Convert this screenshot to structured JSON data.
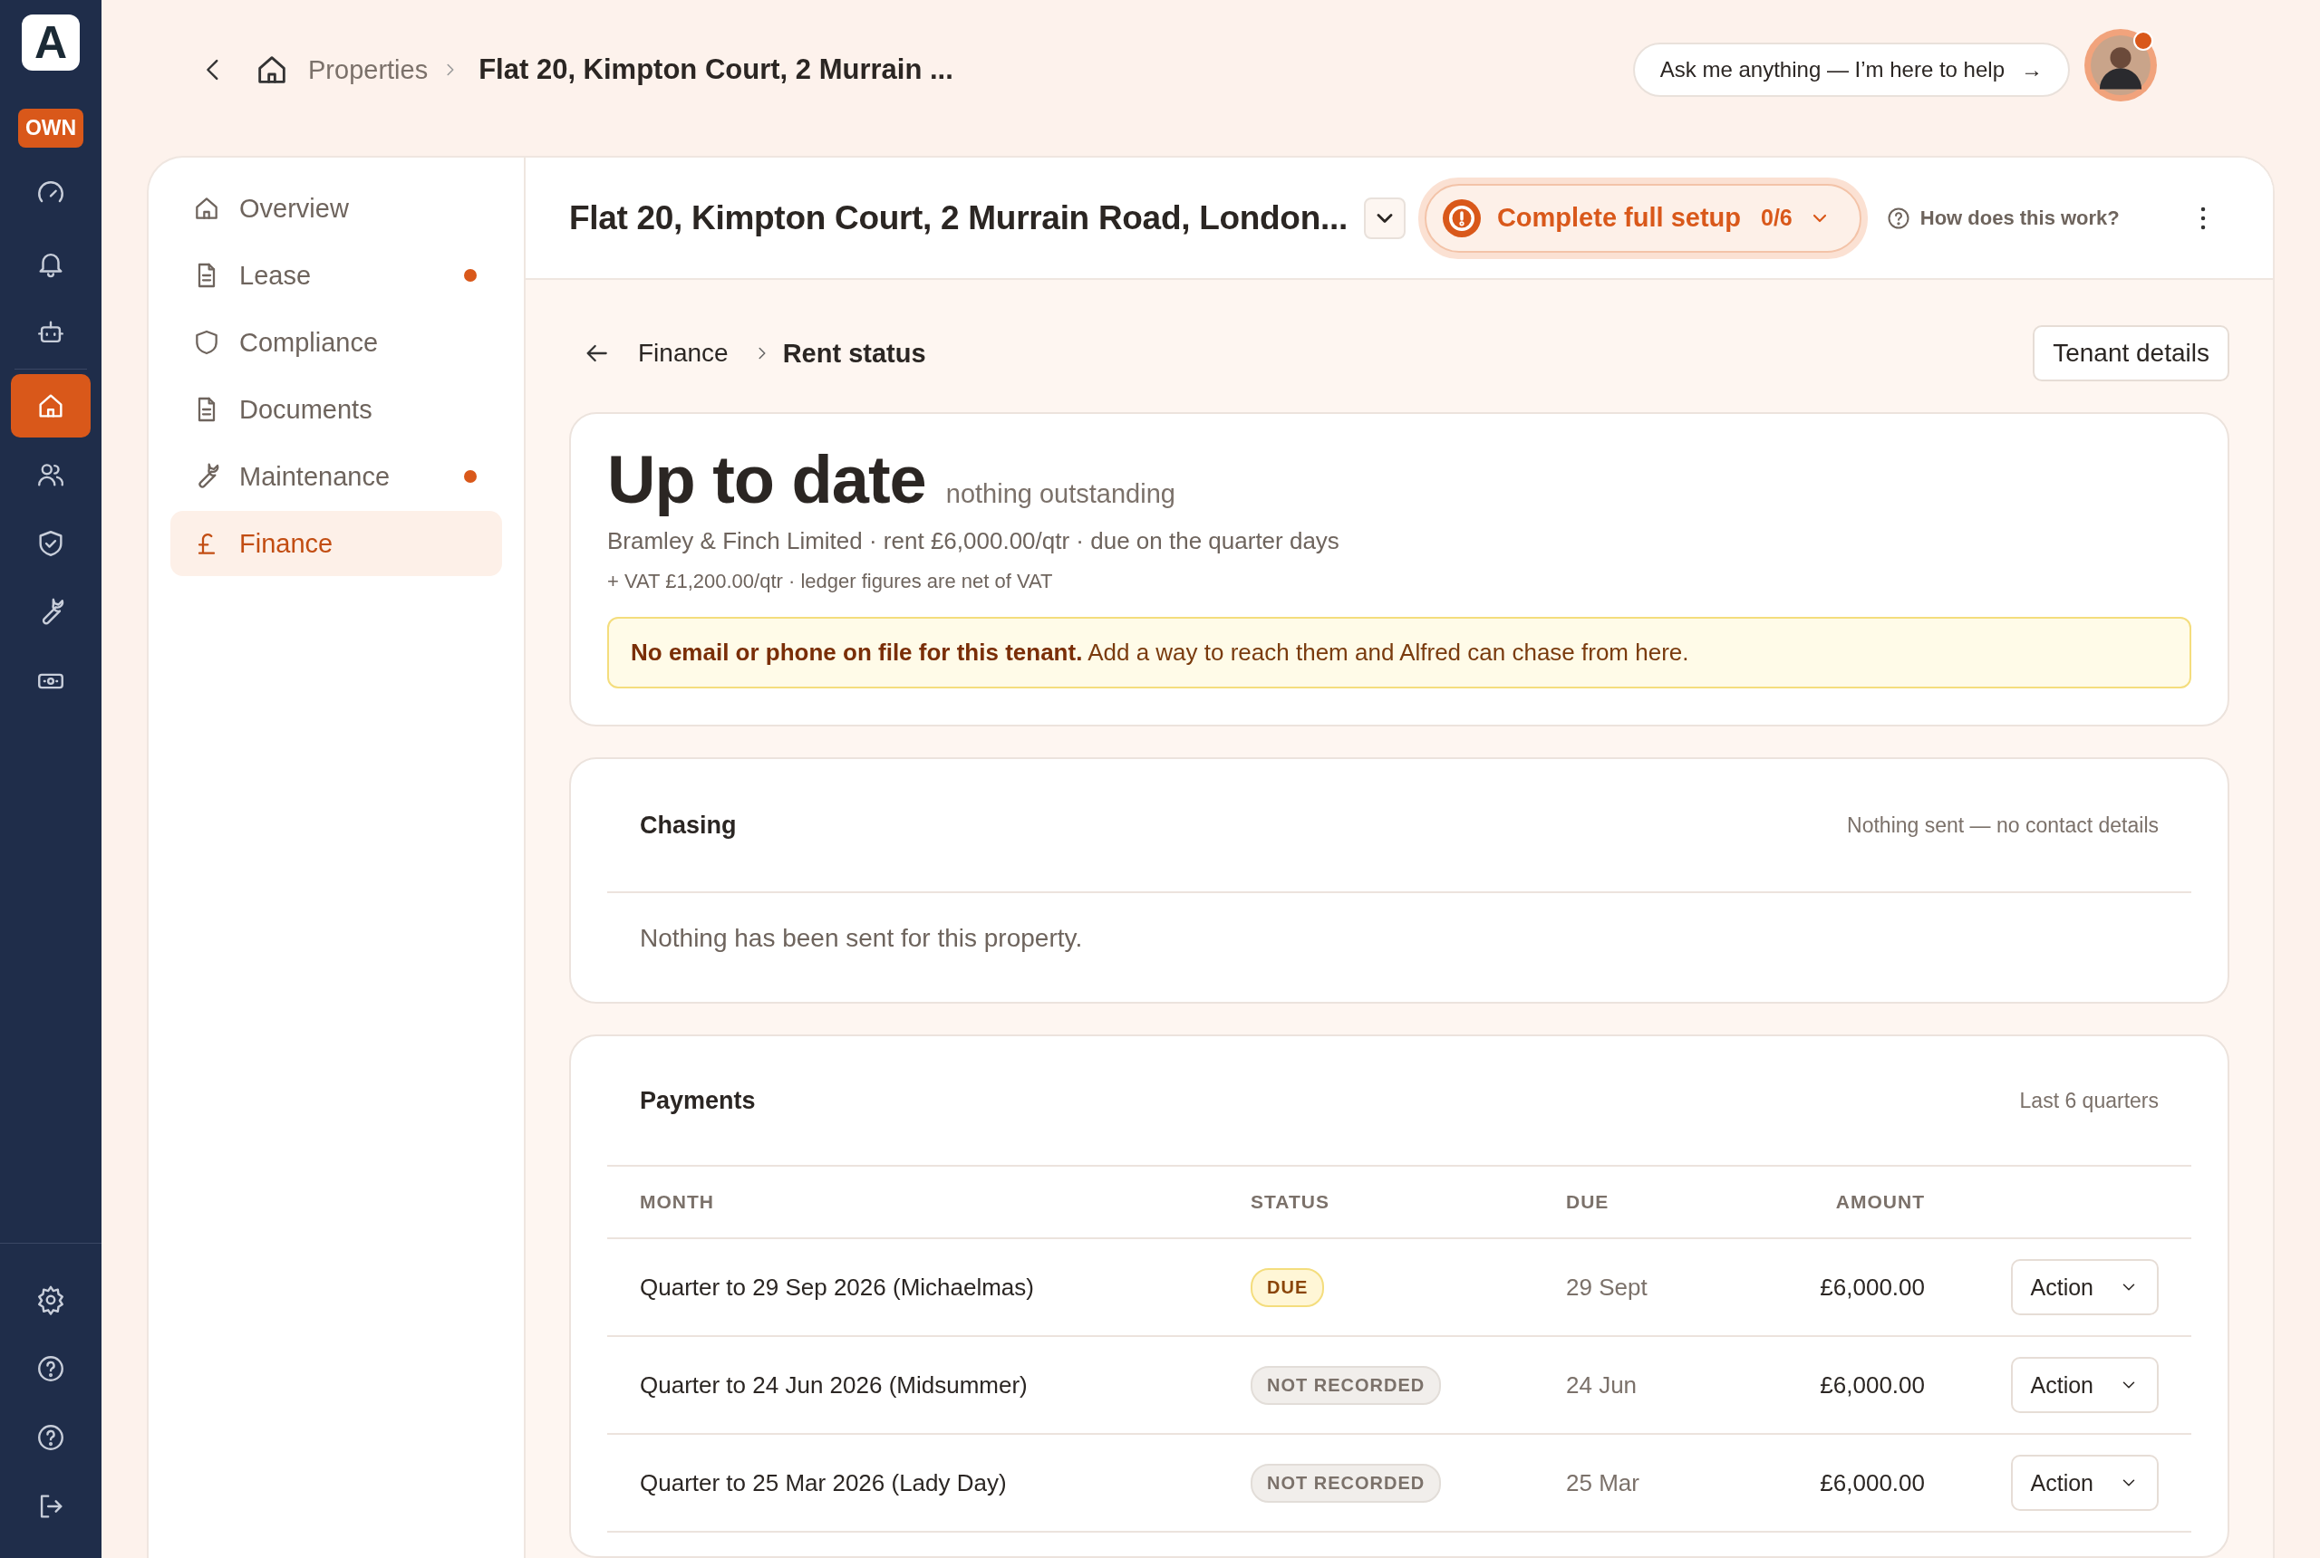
{
  "rail": {
    "logo": "A",
    "badge": "OWN",
    "items": [
      {
        "selected": false
      },
      {
        "selected": false
      },
      {
        "selected": false
      },
      {
        "selected": true
      },
      {
        "selected": false
      },
      {
        "selected": false
      },
      {
        "selected": false
      },
      {
        "selected": false
      }
    ],
    "bottom_items": [
      {
        "selected": false
      },
      {
        "selected": false
      },
      {
        "selected": false
      },
      {
        "selected": false
      }
    ]
  },
  "topbar": {
    "breadcrumb": [
      "Properties",
      "Flat 20, Kimpton Court, 2 Murrain ..."
    ],
    "assistant": "Ask me anything — I’m here to help",
    "assistant_arrow": "→",
    "avatar_notification": true
  },
  "sidebar": {
    "items": [
      {
        "label": "Overview",
        "selected": false,
        "alert": false
      },
      {
        "label": "Lease",
        "selected": false,
        "alert": true
      },
      {
        "label": "Compliance",
        "selected": false,
        "alert": false
      },
      {
        "label": "Documents",
        "selected": false,
        "alert": false
      },
      {
        "label": "Maintenance",
        "selected": false,
        "alert": true
      },
      {
        "label": "Finance",
        "selected": true,
        "alert": false
      }
    ]
  },
  "header": {
    "title": "Flat 20, Kimpton Court, 2 Murrain Road, London...",
    "setup": {
      "label": "Complete full setup",
      "progress": "0/6"
    },
    "help": "How does this work?"
  },
  "breadcrumb": {
    "parent": "Finance",
    "current": "Rent status",
    "button": "Tenant details"
  },
  "summary": {
    "status": "Up to date",
    "note": "nothing outstanding",
    "line1": "Bramley & Finch Limited · rent £6,000.00/qtr · due on the quarter days",
    "line2": "+ VAT £1,200.00/qtr · ledger figures are net of VAT",
    "warning": "**No email or phone on file for this tenant.** Add a way to reach them and Alfred can chase from here."
  },
  "chasing": {
    "title": "Chasing",
    "meta": "Nothing sent — no contact details",
    "body": "Nothing has been sent for this property."
  },
  "payments": {
    "title": "Payments",
    "meta": "Last 6 quarters",
    "columns": [
      "MONTH",
      "STATUS",
      "DUE",
      "AMOUNT"
    ],
    "rows": [
      {
        "month": "Quarter to 29 Sep 2026 (Michaelmas)",
        "status": "DUE",
        "kind": "due",
        "due": "29 Sept",
        "amount": "£6,000.00",
        "action": "Action"
      },
      {
        "month": "Quarter to 24 Jun 2026 (Midsummer)",
        "status": "NOT RECORDED",
        "kind": "not-recorded",
        "due": "24 Jun",
        "amount": "£6,000.00",
        "action": "Action"
      },
      {
        "month": "Quarter to 25 Mar 2026 (Lady Day)",
        "status": "NOT RECORDED",
        "kind": "not-recorded",
        "due": "25 Mar",
        "amount": "£6,000.00",
        "action": "Action"
      }
    ]
  }
}
